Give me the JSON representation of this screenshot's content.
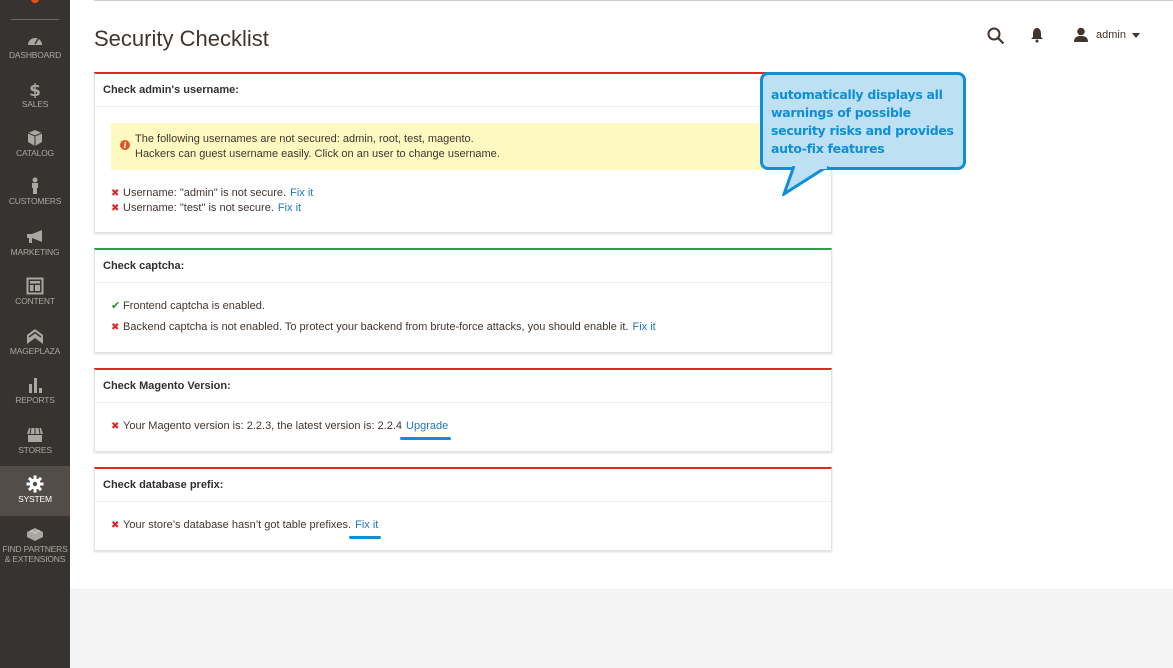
{
  "sidebar": {
    "items": [
      {
        "label": "Dashboard",
        "icon": "dashboard-icon"
      },
      {
        "label": "Sales",
        "icon": "dollar-icon"
      },
      {
        "label": "Catalog",
        "icon": "box-icon"
      },
      {
        "label": "Customers",
        "icon": "person-icon"
      },
      {
        "label": "Marketing",
        "icon": "megaphone-icon"
      },
      {
        "label": "Content",
        "icon": "layout-icon"
      },
      {
        "label": "Mageplaza",
        "icon": "chevrons-up-icon"
      },
      {
        "label": "Reports",
        "icon": "bar-chart-icon"
      },
      {
        "label": "Stores",
        "icon": "storefront-icon"
      },
      {
        "label": "System",
        "icon": "gear-icon",
        "active": true
      },
      {
        "label_line1": "Find Partners",
        "label_line2": "& Extensions",
        "icon": "lego-brick-icon"
      }
    ]
  },
  "header": {
    "title": "Security Checklist",
    "user": "admin"
  },
  "checks": [
    {
      "title": "Check admin's username:",
      "status": "danger",
      "alert": {
        "line1": "The following usernames are not secured: admin, root, test, magento.",
        "line2": "Hackers can guest username easily. Click on an user to change username."
      },
      "items": [
        {
          "status": "fail",
          "text": "Username: \"admin\" is not secure.",
          "link": "Fix it"
        },
        {
          "status": "fail",
          "text": "Username: \"test\" is not secure.",
          "link": "Fix it"
        }
      ]
    },
    {
      "title": "Check captcha:",
      "status": "success",
      "items": [
        {
          "status": "pass",
          "text": "Frontend captcha is enabled."
        },
        {
          "status": "fail",
          "text": "Backend captcha is not enabled. To protect your backend from brute-force attacks, you should enable it.",
          "link": "Fix it"
        }
      ]
    },
    {
      "title": "Check Magento Version:",
      "status": "danger",
      "items": [
        {
          "status": "fail",
          "text": "Your Magento version is: 2.2.3, the latest version is: 2.2.4",
          "link": "Upgrade"
        }
      ]
    },
    {
      "title": "Check database prefix:",
      "status": "danger",
      "items": [
        {
          "status": "fail",
          "text": "Your store’s database hasn’t got table prefixes.",
          "link": "Fix it"
        }
      ]
    }
  ],
  "callout": {
    "text": "automatically displays all warnings of possible security risks and provides auto-fix features"
  },
  "colors": {
    "sidebar_bg": "#373330",
    "danger": "#e22626",
    "success": "#2e9e4f",
    "link": "#1979c3",
    "callout_border": "#0e8fd7",
    "callout_bg": "#bde0f2",
    "alert_bg": "#fcf9c1"
  }
}
